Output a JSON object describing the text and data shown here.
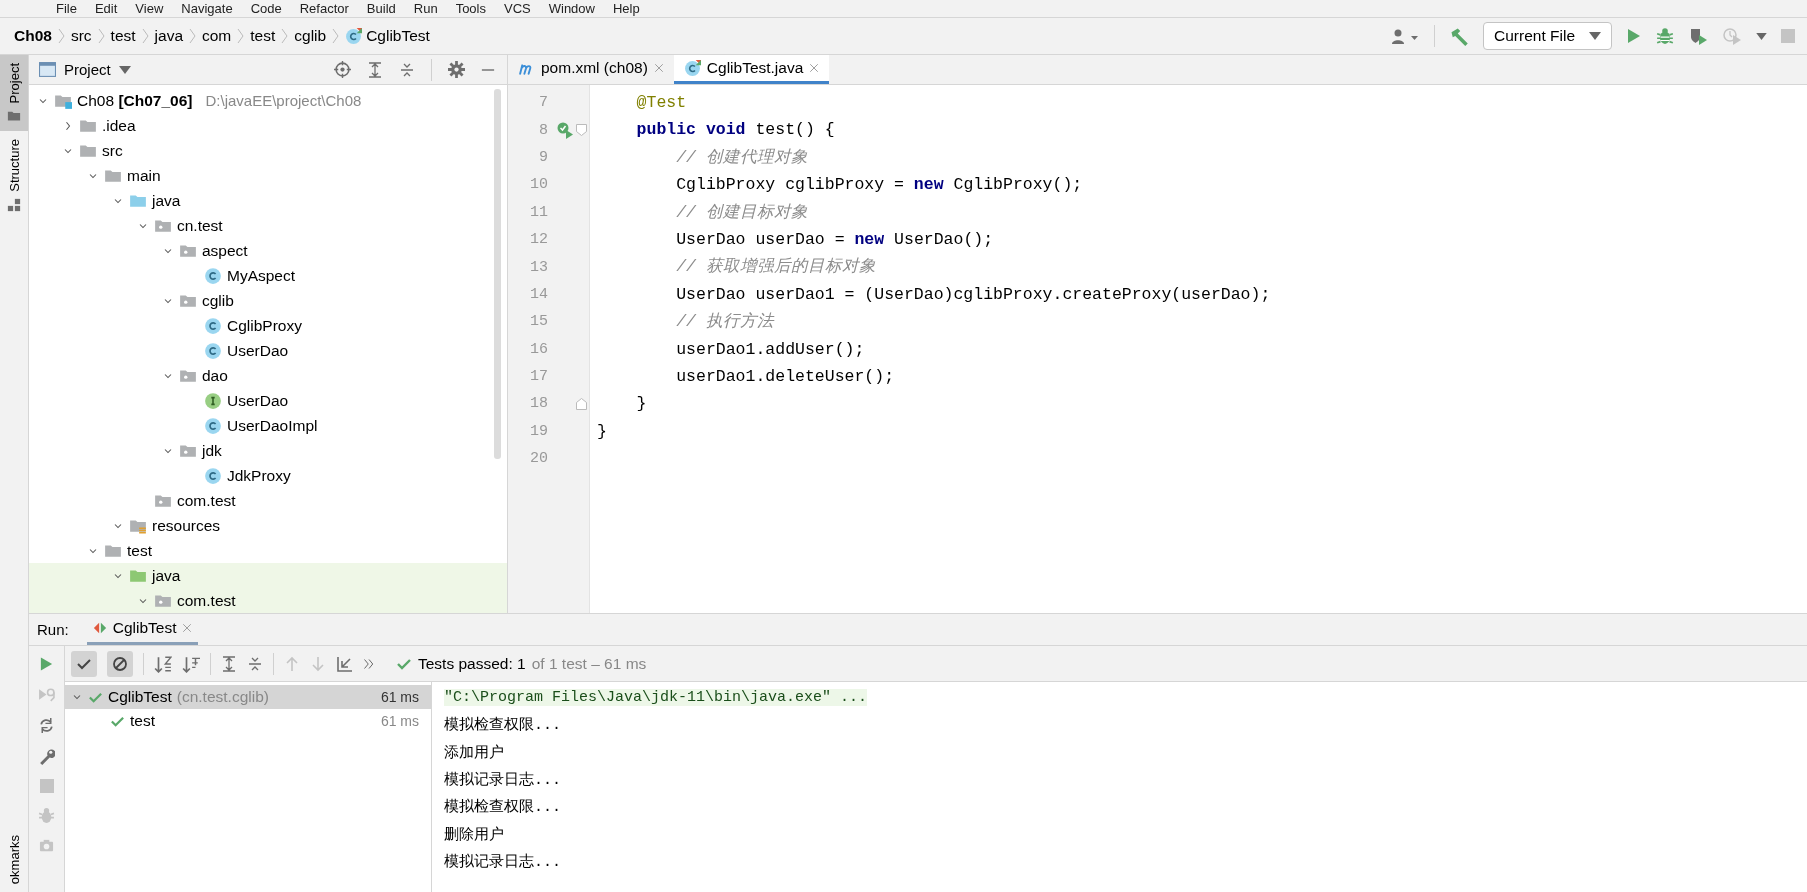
{
  "menu": [
    "File",
    "Edit",
    "View",
    "Navigate",
    "Code",
    "Refactor",
    "Build",
    "Run",
    "Tools",
    "VCS",
    "Window",
    "Help"
  ],
  "breadcrumbs": [
    {
      "label": "Ch08",
      "kind": "project"
    },
    {
      "label": "src",
      "kind": "dir"
    },
    {
      "label": "test",
      "kind": "dir"
    },
    {
      "label": "java",
      "kind": "dir"
    },
    {
      "label": "com",
      "kind": "dir"
    },
    {
      "label": "test",
      "kind": "dir"
    },
    {
      "label": "cglib",
      "kind": "dir"
    },
    {
      "label": "CglibTest",
      "kind": "test-class"
    }
  ],
  "run_configuration": "Current File",
  "side_stripe": [
    {
      "label": "Project",
      "selected": true
    },
    {
      "label": "Structure",
      "selected": false
    },
    {
      "label": "okmarks",
      "selected": false
    }
  ],
  "project_panel": {
    "title": "Project",
    "tree": [
      {
        "label": "Ch08 **[Ch07_06]**",
        "path": "D:\\javaEE\\project\\Ch08",
        "kind": "module",
        "expanded": true,
        "highlighted": false,
        "children": [
          {
            "label": ".idea",
            "kind": "folder",
            "expanded": false,
            "highlighted": false
          },
          {
            "label": "src",
            "kind": "folder",
            "expanded": true,
            "highlighted": false,
            "children": [
              {
                "label": "main",
                "kind": "folder",
                "expanded": true,
                "highlighted": false,
                "children": [
                  {
                    "label": "java",
                    "kind": "source-folder",
                    "expanded": true,
                    "highlighted": false,
                    "children": [
                      {
                        "label": "cn.test",
                        "kind": "package",
                        "expanded": true,
                        "highlighted": false,
                        "children": [
                          {
                            "label": "aspect",
                            "kind": "package",
                            "expanded": true,
                            "highlighted": false,
                            "children": [
                              {
                                "label": "MyAspect",
                                "kind": "class",
                                "highlighted": false
                              }
                            ]
                          },
                          {
                            "label": "cglib",
                            "kind": "package",
                            "expanded": true,
                            "highlighted": false,
                            "children": [
                              {
                                "label": "CglibProxy",
                                "kind": "class",
                                "highlighted": false
                              },
                              {
                                "label": "UserDao",
                                "kind": "class",
                                "highlighted": false
                              }
                            ]
                          },
                          {
                            "label": "dao",
                            "kind": "package",
                            "expanded": true,
                            "highlighted": false,
                            "children": [
                              {
                                "label": "UserDao",
                                "kind": "interface",
                                "highlighted": false
                              },
                              {
                                "label": "UserDaoImpl",
                                "kind": "class",
                                "highlighted": false
                              }
                            ]
                          },
                          {
                            "label": "jdk",
                            "kind": "package",
                            "expanded": true,
                            "highlighted": false,
                            "children": [
                              {
                                "label": "JdkProxy",
                                "kind": "class",
                                "highlighted": false
                              }
                            ]
                          }
                        ]
                      },
                      {
                        "label": "com.test",
                        "kind": "package",
                        "highlighted": false
                      }
                    ]
                  },
                  {
                    "label": "resources",
                    "kind": "resources-folder",
                    "expanded": true,
                    "highlighted": false
                  }
                ]
              },
              {
                "label": "test",
                "kind": "folder",
                "expanded": true,
                "highlighted": false,
                "children": [
                  {
                    "label": "java",
                    "kind": "test-folder",
                    "expanded": true,
                    "highlighted": true,
                    "children": [
                      {
                        "label": "com.test",
                        "kind": "package",
                        "expanded": true,
                        "highlighted": true
                      }
                    ]
                  }
                ]
              }
            ]
          }
        ]
      }
    ]
  },
  "editor_tabs": [
    {
      "label": "pom.xml (ch08)",
      "kind": "maven",
      "selected": false
    },
    {
      "label": "CglibTest.java",
      "kind": "test-class",
      "selected": true
    }
  ],
  "code_lines": [
    {
      "number": "7",
      "kind": "code",
      "parts": [
        {
          "text": "    @Test",
          "kind": "annotation"
        }
      ]
    },
    {
      "number": "8",
      "kind": "test-method-start",
      "parts": [
        {
          "text": "    public void",
          "kind": "keyword"
        },
        {
          "text": " test() {",
          "kind": "plain"
        }
      ]
    },
    {
      "number": "9",
      "kind": "code",
      "parts": [
        {
          "text": "        // 创建代理对象",
          "kind": "comment"
        }
      ]
    },
    {
      "number": "10",
      "kind": "code",
      "parts": [
        {
          "text": "        CglibProxy cglibProxy = ",
          "kind": "plain"
        },
        {
          "text": "new",
          "kind": "keyword"
        },
        {
          "text": " CglibProxy();",
          "kind": "plain"
        }
      ]
    },
    {
      "number": "11",
      "kind": "code",
      "parts": [
        {
          "text": "        // 创建目标对象",
          "kind": "comment"
        }
      ]
    },
    {
      "number": "12",
      "kind": "code",
      "parts": [
        {
          "text": "        UserDao userDao = ",
          "kind": "plain"
        },
        {
          "text": "new",
          "kind": "keyword"
        },
        {
          "text": " UserDao();",
          "kind": "plain"
        }
      ]
    },
    {
      "number": "13",
      "kind": "code",
      "parts": [
        {
          "text": "        // 获取增强后的目标对象",
          "kind": "comment"
        }
      ]
    },
    {
      "number": "14",
      "kind": "code",
      "parts": [
        {
          "text": "        UserDao userDao1 = (UserDao)cglibProxy.createProxy(userDao);",
          "kind": "plain"
        }
      ]
    },
    {
      "number": "15",
      "kind": "code",
      "parts": [
        {
          "text": "        // 执行方法",
          "kind": "comment"
        }
      ]
    },
    {
      "number": "16",
      "kind": "code",
      "parts": [
        {
          "text": "        userDao1.addUser();",
          "kind": "plain"
        }
      ]
    },
    {
      "number": "17",
      "kind": "code",
      "parts": [
        {
          "text": "        userDao1.deleteUser();",
          "kind": "plain"
        }
      ]
    },
    {
      "number": "18",
      "kind": "block-end",
      "parts": [
        {
          "text": "    }",
          "kind": "plain"
        }
      ]
    },
    {
      "number": "19",
      "kind": "code",
      "parts": [
        {
          "text": "}",
          "kind": "plain"
        }
      ]
    },
    {
      "number": "20",
      "kind": "code"
    }
  ],
  "run_panel": {
    "label": "Run:",
    "tab": "CglibTest",
    "toggles": [
      {
        "kind": "show-passed",
        "on": true
      },
      {
        "kind": "show-ignored",
        "on": true
      }
    ],
    "status": "Tests passed: 1",
    "status_detail": "of 1 test – 61 ms",
    "tests": [
      {
        "label": "CglibTest",
        "detail": "(cn.test.cglib)",
        "time": "61 ms",
        "selected": true,
        "expanded": true,
        "children": [
          {
            "label": "test",
            "time": "61 ms",
            "selected": false
          }
        ]
      }
    ],
    "console": [
      {
        "text": "\"C:\\Program Files\\Java\\jdk-11\\bin\\java.exe\" ...",
        "kind": "command"
      },
      {
        "text": "模拟检查权限...",
        "kind": "output"
      },
      {
        "text": "添加用户",
        "kind": "output"
      },
      {
        "text": "模拟记录日志...",
        "kind": "output"
      },
      {
        "text": "模拟检查权限...",
        "kind": "output"
      },
      {
        "text": "删除用户",
        "kind": "output"
      },
      {
        "text": "模拟记录日志...",
        "kind": "output"
      }
    ]
  }
}
